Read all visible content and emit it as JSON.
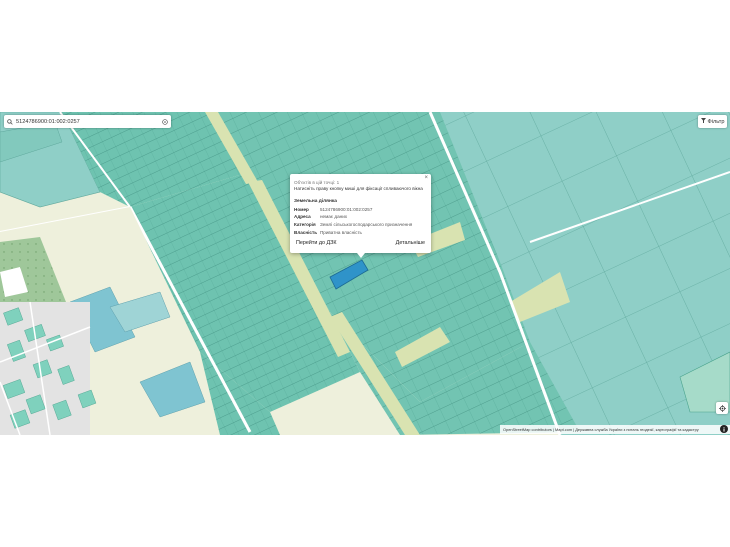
{
  "search": {
    "value": "5124786900:01:002:0257"
  },
  "filter": {
    "label": "Фільтр"
  },
  "popup": {
    "objects_line": "Об'єктів в цій точці: 1",
    "hint_line": "Натисніть праву кнопку миші для фіксації спливаючого вікна",
    "section_title": "Земельна ділянка",
    "rows": [
      {
        "key": "Номер",
        "value": "5124786900:01:002:0257"
      },
      {
        "key": "Адреса",
        "value": "немає даних"
      },
      {
        "key": "Категорія",
        "value": "Землі сільськогосподарського призначення"
      },
      {
        "key": "Власність",
        "value": "Приватна власність"
      }
    ],
    "goto_label": "Перейти до ДЗК",
    "details_label": "Детальніше",
    "close_glyph": "×"
  },
  "attribution": "OpenStreetMap contributors | Mapt.com | Державна служба України з питань геодезії, картографії та кадастру",
  "colors": {
    "parcel": "#6ec3b0",
    "parcel_light": "#8fd0c2",
    "selected": "#2f93c9",
    "sand": "#d9e3b1",
    "road": "#ffffff",
    "background": "#eef0dc"
  },
  "icons": [
    "search-icon",
    "clear-icon",
    "filter-icon",
    "locate-icon",
    "info-icon",
    "close-icon"
  ]
}
